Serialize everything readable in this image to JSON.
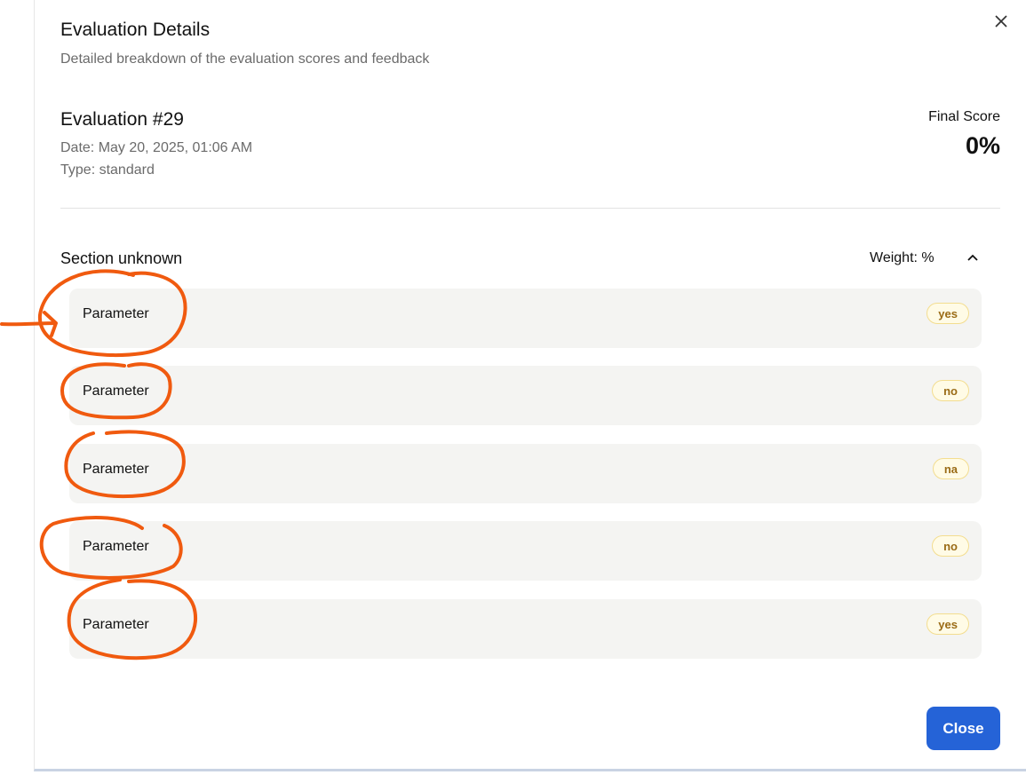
{
  "dialog": {
    "title": "Evaluation Details",
    "subtitle": "Detailed breakdown of the evaluation scores and feedback",
    "close_label": "Close"
  },
  "evaluation": {
    "title": "Evaluation #29",
    "date": "Date: May 20, 2025, 01:06 AM",
    "type": "Type: standard",
    "final_score_label": "Final Score",
    "final_score_value": "0%"
  },
  "section": {
    "title": "Section unknown",
    "weight": "Weight: %",
    "parameters": [
      {
        "label": "Parameter",
        "answer": "yes"
      },
      {
        "label": "Parameter",
        "answer": "no"
      },
      {
        "label": "Parameter",
        "answer": "na"
      },
      {
        "label": "Parameter",
        "answer": "no"
      },
      {
        "label": "Parameter",
        "answer": "yes"
      }
    ]
  },
  "colors": {
    "primary": "#2563d7",
    "badge_bg": "#fffbe6",
    "badge_text": "#9a6b16",
    "annotation": "#f05a0f"
  },
  "icons": {
    "close": "close-icon",
    "collapse": "chevron-up-icon"
  }
}
